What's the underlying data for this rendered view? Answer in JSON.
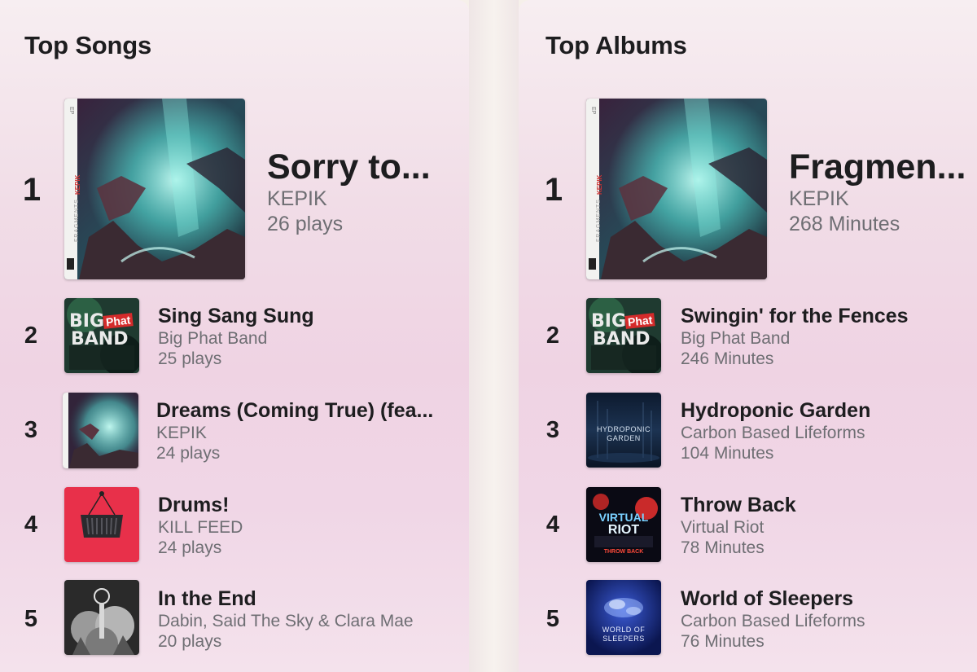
{
  "songs": {
    "title": "Top Songs",
    "items": [
      {
        "rank": "1",
        "name": "Sorry to...",
        "artist": "KEPIK",
        "stat": "26 plays"
      },
      {
        "rank": "2",
        "name": "Sing Sang Sung",
        "artist": "Big Phat Band",
        "stat": "25 plays"
      },
      {
        "rank": "3",
        "name": "Dreams (Coming True) (fea...",
        "artist": "KEPIK",
        "stat": "24 plays"
      },
      {
        "rank": "4",
        "name": "Drums!",
        "artist": "KILL FEED",
        "stat": "24 plays"
      },
      {
        "rank": "5",
        "name": "In the End",
        "artist": "Dabin, Said The Sky & Clara Mae",
        "stat": "20 plays"
      }
    ]
  },
  "albums": {
    "title": "Top Albums",
    "items": [
      {
        "rank": "1",
        "name": "Fragmen...",
        "artist": "KEPIK",
        "stat": "268 Minutes"
      },
      {
        "rank": "2",
        "name": "Swingin' for the Fences",
        "artist": "Big Phat Band",
        "stat": "246 Minutes"
      },
      {
        "rank": "3",
        "name": "Hydroponic Garden",
        "artist": "Carbon Based Lifeforms",
        "stat": "104 Minutes"
      },
      {
        "rank": "4",
        "name": "Throw Back",
        "artist": "Virtual Riot",
        "stat": "78 Minutes"
      },
      {
        "rank": "5",
        "name": "World of Sleepers",
        "artist": "Carbon Based Lifeforms",
        "stat": "76 Minutes"
      }
    ]
  },
  "covers": {
    "fragments_spine_top": "EP",
    "fragments_spine_artist": "KEPIK",
    "fragments_spine_title": "FRAGMENTS",
    "bigphat_big": "BIG",
    "bigphat_phat": "Phat",
    "bigphat_band": "BAND",
    "hydroponic_line1": "HYDROPONIC",
    "hydroponic_line2": "GARDEN",
    "virtualriot_line1": "VIRTUAL",
    "virtualriot_line2": "RIOT",
    "virtualriot_subtitle": "THROW BACK",
    "sleepers_line1": "WORLD OF",
    "sleepers_line2": "SLEEPERS"
  }
}
